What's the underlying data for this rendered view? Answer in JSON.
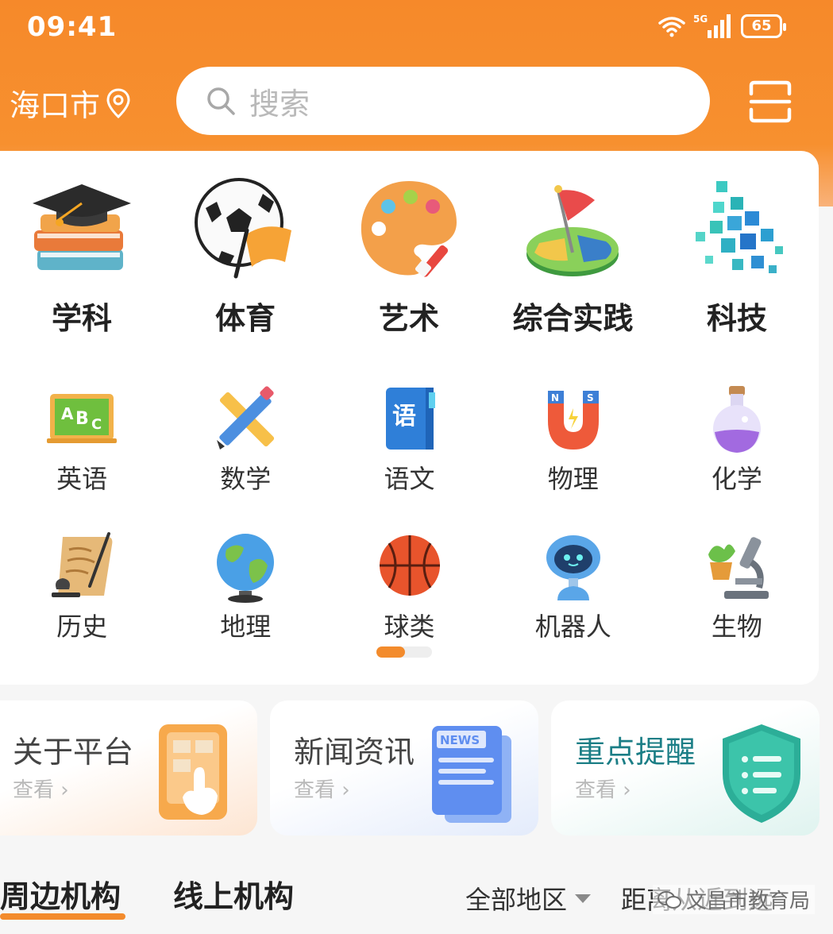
{
  "status_bar": {
    "time": "09:41",
    "network": "5G",
    "battery": "65"
  },
  "header": {
    "city": "海口市",
    "search_placeholder": "搜索"
  },
  "featured_categories": [
    {
      "label": "学科",
      "icon": "graduation-cap-icon"
    },
    {
      "label": "体育",
      "icon": "soccer-ball-icon"
    },
    {
      "label": "艺术",
      "icon": "paint-palette-icon"
    },
    {
      "label": "综合实践",
      "icon": "flag-map-icon"
    },
    {
      "label": "科技",
      "icon": "cubes-tech-icon"
    }
  ],
  "subject_row_1": [
    {
      "label": "英语",
      "icon": "abc-board-icon"
    },
    {
      "label": "数学",
      "icon": "pencil-ruler-icon"
    },
    {
      "label": "语文",
      "icon": "chinese-book-icon"
    },
    {
      "label": "物理",
      "icon": "magnet-icon"
    },
    {
      "label": "化学",
      "icon": "flask-icon"
    }
  ],
  "subject_row_2": [
    {
      "label": "历史",
      "icon": "scroll-icon"
    },
    {
      "label": "地理",
      "icon": "globe-icon"
    },
    {
      "label": "球类",
      "icon": "basketball-icon"
    },
    {
      "label": "机器人",
      "icon": "robot-icon"
    },
    {
      "label": "生物",
      "icon": "microscope-icon"
    }
  ],
  "pager": {
    "pages": 2,
    "active": 1
  },
  "banners": [
    {
      "title": "关于平台",
      "link": "查看",
      "icon": "phone-tap-icon"
    },
    {
      "title": "新闻资讯",
      "link": "查看",
      "icon": "news-icon",
      "icon_text": "NEWS"
    },
    {
      "title": "重点提醒",
      "link": "查看",
      "icon": "shield-list-icon"
    }
  ],
  "tabs": {
    "nearby": "周边机构",
    "online": "线上机构",
    "active": "nearby"
  },
  "filters": {
    "region": "全部地区",
    "distance": "距离从近到远"
  },
  "watermark": "文昌市教育局",
  "colors": {
    "brand": "#f38b2c",
    "reminder_teal": "#1b7e86"
  }
}
